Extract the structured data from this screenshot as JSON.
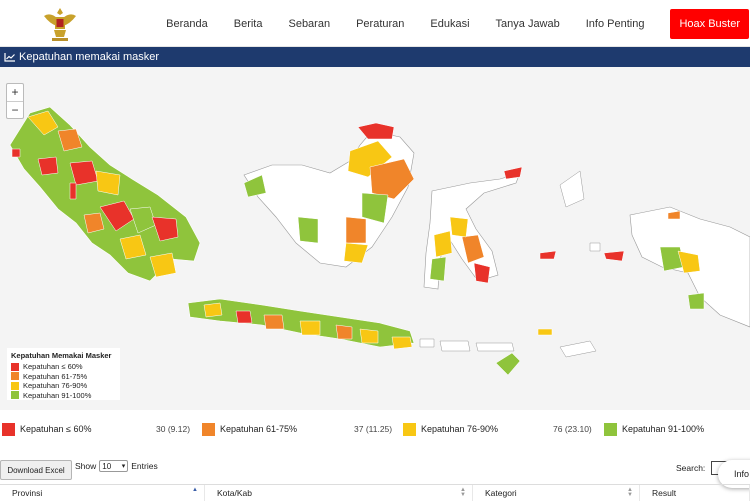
{
  "nav": {
    "items": [
      "Beranda",
      "Berita",
      "Sebaran",
      "Peraturan",
      "Edukasi",
      "Tanya Jawab",
      "Info Penting"
    ],
    "hoax_button": "Hoax Buster"
  },
  "section": {
    "title": "Kepatuhan memakai masker",
    "icon": "chart-line-icon"
  },
  "map": {
    "zoom_in": "+",
    "zoom_out": "−",
    "legend": {
      "title": "Kepatuhan Memakai Masker",
      "items": [
        {
          "label": "Kepatuhan ≤ 60%",
          "color": "#e8322a"
        },
        {
          "label": "Kepatuhan 61-75%",
          "color": "#f0852a"
        },
        {
          "label": "Kepatuhan 76-90%",
          "color": "#f8c714"
        },
        {
          "label": "Kepatuhan 91-100%",
          "color": "#8fc43c"
        }
      ]
    }
  },
  "summary": [
    {
      "label": "Kepatuhan ≤ 60%",
      "count": "30 (9.12)",
      "color": "#e8322a"
    },
    {
      "label": "Kepatuhan 61-75%",
      "count": "37 (11.25)",
      "color": "#f0852a"
    },
    {
      "label": "Kepatuhan 76-90%",
      "count": "76 (23.10)",
      "color": "#f8c714"
    },
    {
      "label": "Kepatuhan 91-100%",
      "count": "",
      "color": "#8fc43c"
    }
  ],
  "table": {
    "download_label": "Download Excel",
    "show_label": "Show",
    "show_value": "10",
    "entries_label": "Entries",
    "search_label": "Search:",
    "info_label": "Info",
    "columns": [
      "Provinsi",
      "Kota/Kab",
      "Kategori",
      "Result"
    ]
  }
}
